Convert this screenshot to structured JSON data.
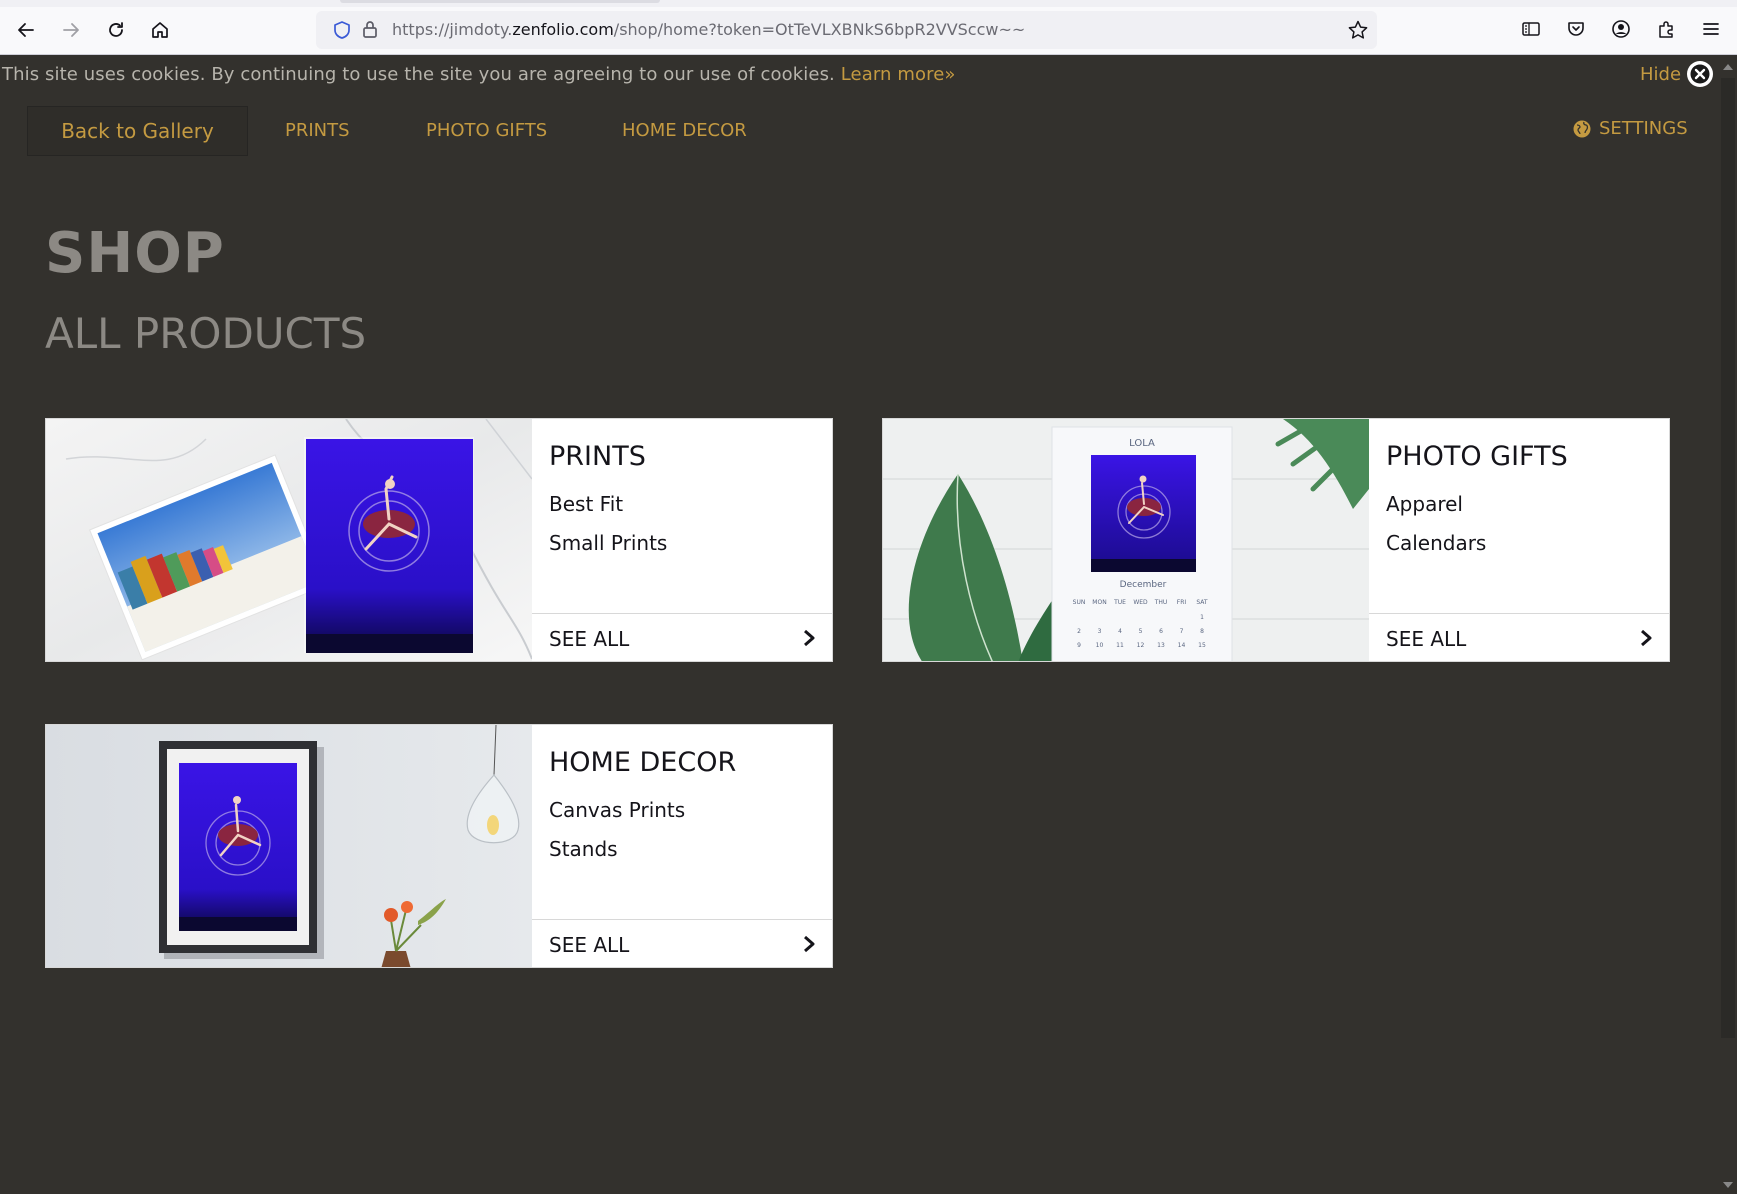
{
  "browser": {
    "url_prefix": "https://jimdoty.",
    "url_domain": "zenfolio.com",
    "url_path": "/shop/home?token=OtTeVLXBNkS6bpR2VVSccw~~"
  },
  "cookie_bar": {
    "text": "This site uses cookies. By continuing to use the site you are agreeing to our use of cookies.",
    "learn_more": "Learn more»",
    "hide": "Hide"
  },
  "nav": {
    "back": "Back to Gallery",
    "prints": "PRINTS",
    "photo_gifts": "PHOTO GIFTS",
    "home_decor": "HOME DECOR",
    "settings": "SETTINGS"
  },
  "page": {
    "title": "SHOP",
    "subtitle": "ALL PRODUCTS"
  },
  "cards": [
    {
      "title": "PRINTS",
      "items": [
        "Best Fit",
        "Small Prints"
      ],
      "see_all": "SEE ALL"
    },
    {
      "title": "PHOTO GIFTS",
      "items": [
        "Apparel",
        "Calendars"
      ],
      "see_all": "SEE ALL"
    },
    {
      "title": "HOME DECOR",
      "items": [
        "Canvas Prints",
        "Stands"
      ],
      "see_all": "SEE ALL"
    }
  ],
  "calendar": {
    "name": "LOLA",
    "month": "December",
    "days": [
      "SUN",
      "MON",
      "TUE",
      "WED",
      "THU",
      "FRI",
      "SAT"
    ],
    "row1": [
      "",
      "",
      "",
      "",
      "",
      "",
      "1"
    ],
    "row2": [
      "2",
      "3",
      "4",
      "5",
      "6",
      "7",
      "8"
    ],
    "row3": [
      "9",
      "10",
      "11",
      "12",
      "13",
      "14",
      "15"
    ]
  },
  "colors": {
    "background": "#33312d",
    "accent": "#c49a41",
    "heading": "#8c8984"
  }
}
